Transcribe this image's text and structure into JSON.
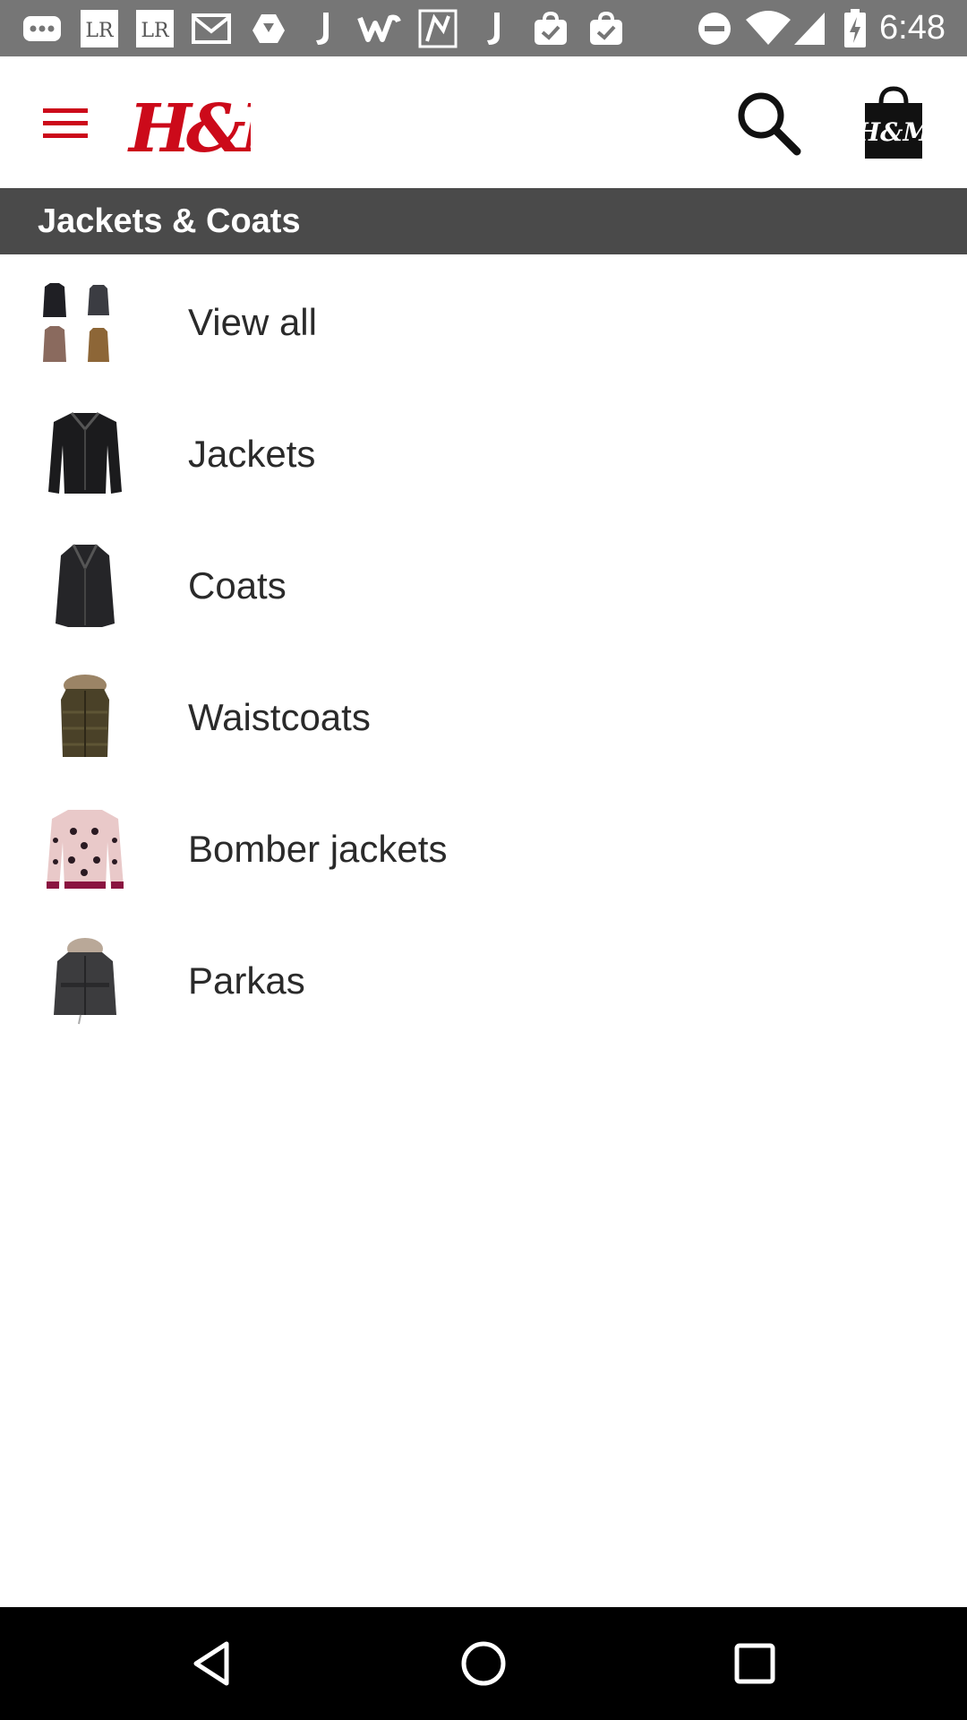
{
  "status_bar": {
    "time": "6:48",
    "notification_icons": [
      "dots-icon",
      "lightroom-icon",
      "lightroom-icon",
      "gmail-icon",
      "drive-icon",
      "j-app-icon",
      "w-app-icon",
      "maps-icon",
      "j-app-icon",
      "shopping-bag-check-icon",
      "shopping-bag-check-icon"
    ],
    "system_icons": [
      "do-not-disturb-icon",
      "wifi-icon",
      "cell-signal-icon",
      "battery-charging-icon"
    ]
  },
  "header": {
    "logo_text": "H&M",
    "brand_color": "#cc0a1a"
  },
  "category": {
    "title": "Jackets & Coats"
  },
  "list": {
    "items": [
      {
        "label": "View all",
        "thumb": "view-all-thumbnail"
      },
      {
        "label": "Jackets",
        "thumb": "jacket-thumbnail"
      },
      {
        "label": "Coats",
        "thumb": "coat-thumbnail"
      },
      {
        "label": "Waistcoats",
        "thumb": "waistcoat-thumbnail"
      },
      {
        "label": "Bomber jackets",
        "thumb": "bomber-jacket-thumbnail"
      },
      {
        "label": "Parkas",
        "thumb": "parka-thumbnail"
      }
    ]
  },
  "nav_bar": {
    "buttons": [
      "back-icon",
      "home-icon",
      "recents-icon"
    ]
  },
  "colors": {
    "status_bar": "#767676",
    "category_bar": "#4a4a4a",
    "nav_bar": "#000000"
  }
}
